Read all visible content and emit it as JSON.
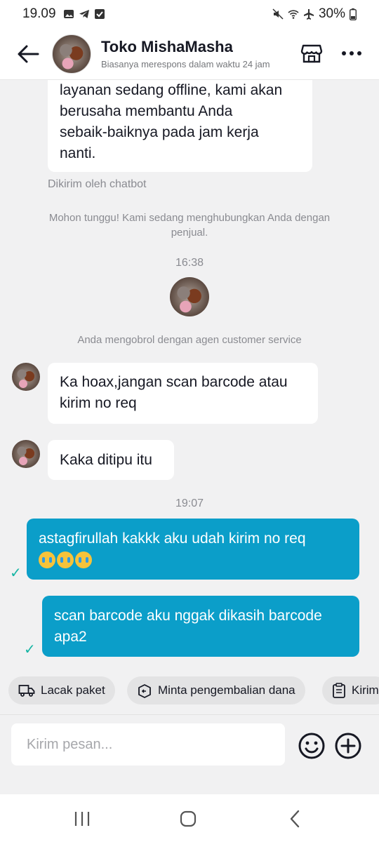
{
  "status_bar": {
    "time": "19.09",
    "battery": "30%"
  },
  "header": {
    "shop_name": "Toko MishaMasha",
    "subtitle": "Biasanya merespons dalam waktu 24 jam"
  },
  "messages": {
    "bot_text": [
      "layanan sedang offline, kami akan",
      "berusaha membantu Anda",
      "sebaik-baiknya pada jam kerja",
      "nanti."
    ],
    "bot_caption": "Dikirim oleh chatbot",
    "connecting": [
      "Mohon tunggu! Kami sedang menghubungkan Anda dengan",
      "penjual."
    ],
    "time_1": "16:38",
    "agent_notice": "Anda mengobrol dengan agen customer service",
    "agent_msg_1": [
      "Ka hoax,jangan scan barcode atau",
      "kirim no req"
    ],
    "agent_msg_2": "Kaka ditipu itu",
    "time_2": "19:07",
    "my_msg_1": "astagfirullah kakkk aku udah kirim no req",
    "my_msg_2": [
      "scan barcode aku nggak dikasih barcode",
      "apa2"
    ]
  },
  "quick_actions": {
    "track": "Lacak paket",
    "refund": "Minta pengembalian dana",
    "send": "Kirim"
  },
  "composer": {
    "placeholder": "Kirim pesan..."
  },
  "colors": {
    "outgoing_bubble": "#0b9ec9",
    "read_check": "#16b5a4"
  }
}
